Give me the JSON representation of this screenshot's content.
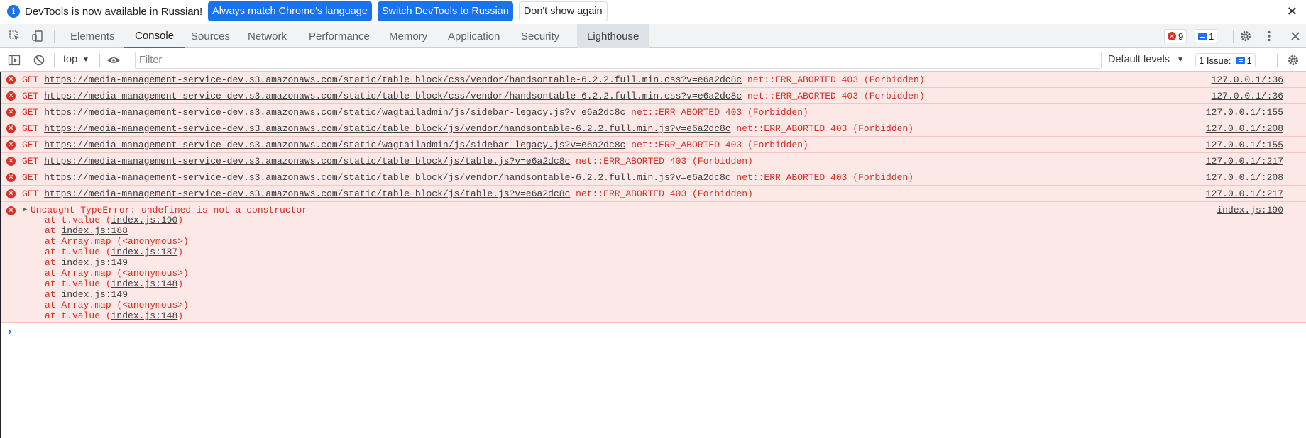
{
  "infobar": {
    "message": "DevTools is now available in Russian!",
    "btn_match": "Always match Chrome's language",
    "btn_switch": "Switch DevTools to Russian",
    "btn_dismiss": "Don't show again",
    "close": "✕"
  },
  "tabs": {
    "elements": "Elements",
    "console": "Console",
    "sources": "Sources",
    "network": "Network",
    "performance": "Performance",
    "memory": "Memory",
    "application": "Application",
    "security": "Security",
    "lighthouse": "Lighthouse"
  },
  "counters": {
    "errors": "9",
    "messages": "1"
  },
  "toolbar": {
    "context": "top",
    "filter_placeholder": "Filter",
    "levels": "Default levels",
    "issues_label": "1 Issue:",
    "issues_count": "1"
  },
  "messages": [
    {
      "method": "GET",
      "url": "https://media-management-service-dev.s3.amazonaws.com/static/table_block/css/vendor/handsontable-6.2.2.full.min.css?v=e6a2dc8c",
      "status": "net::ERR_ABORTED 403 (Forbidden)",
      "source": "127.0.0.1/:36"
    },
    {
      "method": "GET",
      "url": "https://media-management-service-dev.s3.amazonaws.com/static/table_block/css/vendor/handsontable-6.2.2.full.min.css?v=e6a2dc8c",
      "status": "net::ERR_ABORTED 403 (Forbidden)",
      "source": "127.0.0.1/:36"
    },
    {
      "method": "GET",
      "url": "https://media-management-service-dev.s3.amazonaws.com/static/wagtailadmin/js/sidebar-legacy.js?v=e6a2dc8c",
      "status": "net::ERR_ABORTED 403 (Forbidden)",
      "source": "127.0.0.1/:155"
    },
    {
      "method": "GET",
      "url": "https://media-management-service-dev.s3.amazonaws.com/static/table_block/js/vendor/handsontable-6.2.2.full.min.js?v=e6a2dc8c",
      "status": "net::ERR_ABORTED 403 (Forbidden)",
      "source": "127.0.0.1/:208"
    },
    {
      "method": "GET",
      "url": "https://media-management-service-dev.s3.amazonaws.com/static/wagtailadmin/js/sidebar-legacy.js?v=e6a2dc8c",
      "status": "net::ERR_ABORTED 403 (Forbidden)",
      "source": "127.0.0.1/:155"
    },
    {
      "method": "GET",
      "url": "https://media-management-service-dev.s3.amazonaws.com/static/table_block/js/table.js?v=e6a2dc8c",
      "status": "net::ERR_ABORTED 403 (Forbidden)",
      "source": "127.0.0.1/:217"
    },
    {
      "method": "GET",
      "url": "https://media-management-service-dev.s3.amazonaws.com/static/table_block/js/vendor/handsontable-6.2.2.full.min.js?v=e6a2dc8c",
      "status": "net::ERR_ABORTED 403 (Forbidden)",
      "source": "127.0.0.1/:208"
    },
    {
      "method": "GET",
      "url": "https://media-management-service-dev.s3.amazonaws.com/static/table_block/js/table.js?v=e6a2dc8c",
      "status": "net::ERR_ABORTED 403 (Forbidden)",
      "source": "127.0.0.1/:217"
    }
  ],
  "exception": {
    "head": "Uncaught TypeError: undefined is not a constructor",
    "source": "index.js:190",
    "stack": [
      {
        "prefix": "at t.value (",
        "link": "index.js:190",
        "suffix": ")"
      },
      {
        "prefix": "at ",
        "link": "index.js:188",
        "suffix": ""
      },
      {
        "prefix": "at Array.map (<anonymous>)",
        "link": "",
        "suffix": ""
      },
      {
        "prefix": "at t.value (",
        "link": "index.js:187",
        "suffix": ")"
      },
      {
        "prefix": "at ",
        "link": "index.js:149",
        "suffix": ""
      },
      {
        "prefix": "at Array.map (<anonymous>)",
        "link": "",
        "suffix": ""
      },
      {
        "prefix": "at t.value (",
        "link": "index.js:148",
        "suffix": ")"
      },
      {
        "prefix": "at ",
        "link": "index.js:149",
        "suffix": ""
      },
      {
        "prefix": "at Array.map (<anonymous>)",
        "link": "",
        "suffix": ""
      },
      {
        "prefix": "at t.value (",
        "link": "index.js:148",
        "suffix": ")"
      }
    ]
  },
  "prompt": "›"
}
